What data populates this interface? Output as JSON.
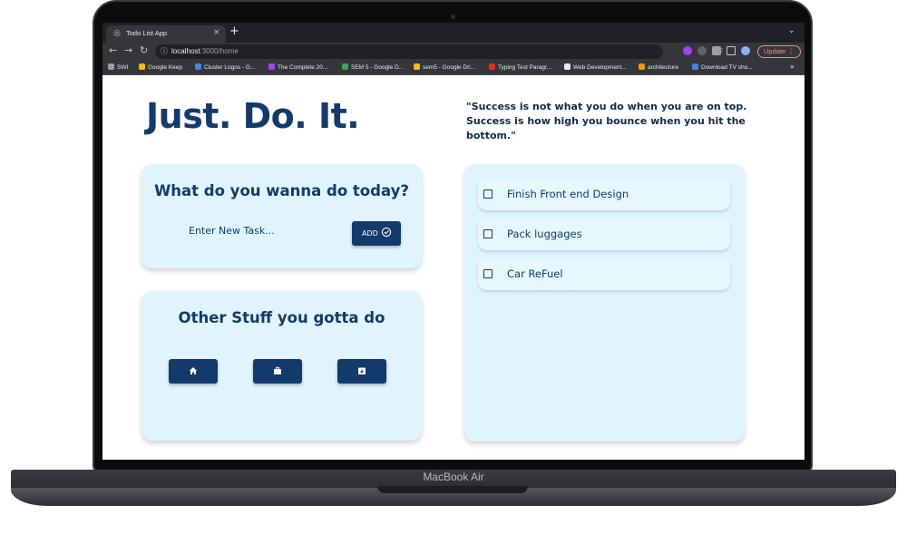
{
  "browser": {
    "tab_title": "Todo List App",
    "url_host": "localhost",
    "url_path": ":3000/home",
    "update_label": "Update",
    "bookmarks": [
      {
        "label": "SWI",
        "color": "#9aa0a6"
      },
      {
        "label": "Google Keep",
        "color": "#fbbc04"
      },
      {
        "label": "Cluster Logos - G...",
        "color": "#4285f4"
      },
      {
        "label": "The Complete 20...",
        "color": "#a142f4"
      },
      {
        "label": "SEM 5 - Google D...",
        "color": "#34a853"
      },
      {
        "label": "sem5 - Google Dri...",
        "color": "#fbbc04"
      },
      {
        "label": "Typing Test Paragr...",
        "color": "#d93025"
      },
      {
        "label": "Web Development...",
        "color": "#e8eaed"
      },
      {
        "label": "architecture",
        "color": "#f29900"
      },
      {
        "label": "Download TV sho...",
        "color": "#4285f4"
      }
    ]
  },
  "app": {
    "title": "Just. Do. It.",
    "quote": "\"Success is not what you do when you are on top. Success is how high you bounce when you hit the bottom.\"",
    "add_card": {
      "heading": "What do you wanna do today?",
      "input_placeholder": "Enter New Task...",
      "add_label": "ADD"
    },
    "other_card": {
      "heading": "Other Stuff you gotta do",
      "categories": [
        {
          "icon": "home-icon"
        },
        {
          "icon": "briefcase-icon"
        },
        {
          "icon": "archive-icon"
        }
      ]
    },
    "todos": [
      {
        "text": "Finish Front end Design",
        "checked": false
      },
      {
        "text": "Pack luggages",
        "checked": false
      },
      {
        "text": "Car ReFuel",
        "checked": false
      }
    ]
  },
  "device": {
    "label": "MacBook Air"
  },
  "colors": {
    "primary": "#123a6b",
    "card_bg": "#dff4fd",
    "item_bg": "#e6f8fe"
  }
}
